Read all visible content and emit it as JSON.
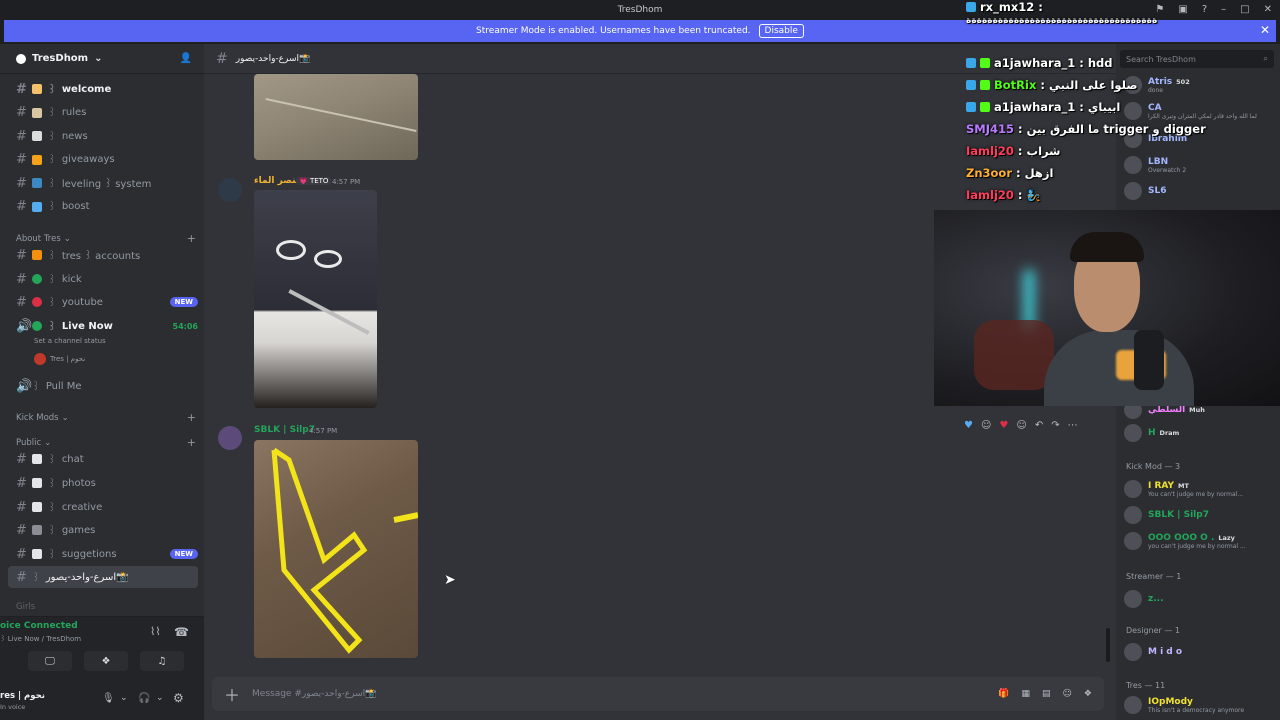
{
  "window": {
    "title": "TresDhom"
  },
  "banner": {
    "text": "Streamer Mode is enabled. Usernames have been truncated.",
    "button": "Disable"
  },
  "server": {
    "name": "TresDhom"
  },
  "channels": [
    {
      "label": "welcome",
      "emoji_color": "#f5c06b",
      "bold": true
    },
    {
      "label": "rules",
      "emoji_color": "#d9c7a4"
    },
    {
      "label": "news",
      "emoji_color": "#dcdcdc"
    },
    {
      "label": "giveaways",
      "emoji_color": "#f7a21b"
    },
    {
      "label": "leveling ꒱ system",
      "emoji_color": "#3b88c3"
    },
    {
      "label": "boost",
      "emoji_color": "#55acee"
    }
  ],
  "categories": {
    "about": "About Tres",
    "kickmods": "Kick Mods",
    "public": "Public",
    "girls": "Girls"
  },
  "about_channels": [
    {
      "label": "tres ꒱ accounts",
      "emoji_color": "#f4900c"
    },
    {
      "label": "kick",
      "emoji_color": "#23a55a"
    },
    {
      "label": "youtube",
      "emoji_color": "#da2f47",
      "badge": "NEW"
    },
    {
      "label": "Live Now",
      "emoji_color": "#23a55a",
      "timer": "54:06",
      "bold": true
    },
    {
      "label": "Pull Me"
    }
  ],
  "live_status": "Set a channel status",
  "live_user": "Tres | نحوم",
  "public_channels": [
    {
      "label": "chat",
      "emoji_color": "#e3e5e8"
    },
    {
      "label": "photos",
      "emoji_color": "#e3e5e8"
    },
    {
      "label": "creative",
      "emoji_color": "#e3e5e8"
    },
    {
      "label": "games",
      "emoji_color": "#8a8e94"
    },
    {
      "label": "suggetions",
      "emoji_color": "#e3e5e8",
      "badge": "NEW"
    },
    {
      "label": "اسرع-واحد-يصور📸",
      "active": true
    }
  ],
  "voice": {
    "status": "oice Connected",
    "sub": "꒱ Live Now / TresDhom",
    "user": "res | نحوم",
    "user_sub": "In voice"
  },
  "main": {
    "channel": "اسرع-واحد-يصور📸",
    "messages": [
      {
        "author": "عنصر الماء",
        "tag": "TETO",
        "time": "4:57 PM",
        "color": "#f0b232"
      },
      {
        "author": "SBLK | Silp7",
        "time": "4:57 PM",
        "color": "#23a55a"
      }
    ],
    "composer_placeholder": "Message #اسرع-واحد-يصور📸"
  },
  "members": {
    "search_placeholder": "Search TresDhom",
    "top": [
      {
        "name": "Atris",
        "badge": "502",
        "sub": "done",
        "color": "#a5b8ff"
      },
      {
        "name": "CA",
        "sub": "لما الله واحد قادر لمكي المثران وتيرى الكرا",
        "color": "#a5b8ff"
      },
      {
        "name": "Ibrahim",
        "color": "#a5b8ff"
      },
      {
        "name": "LBN",
        "sub": "Overwatch 2",
        "color": "#a5b8ff"
      },
      {
        "name": "SL6",
        "color": "#a5b8ff"
      }
    ],
    "under": [
      {
        "name": "السلطي",
        "badge": "Muh",
        "color": "#f47fff"
      },
      {
        "name": "H",
        "badge": "Dram",
        "color": "#23a55a"
      }
    ],
    "kickmod_header": "Kick Mod — 3",
    "kickmods": [
      {
        "name": "I RAY",
        "badge": "MT",
        "sub": "You can't judge me by normal...",
        "color": "#f0e130"
      },
      {
        "name": "SBLK | Silp7",
        "color": "#23a55a"
      },
      {
        "name": "ΟΟΟ ΟΟΟ Ο .",
        "badge": "Lazy",
        "sub": "you can't judge me by normal ...",
        "color": "#23a55a"
      }
    ],
    "streamer_header": "Streamer — 1",
    "streamer": {
      "name": "z...",
      "color": "#23a55a"
    },
    "designer_header": "Designer — 1",
    "designer": {
      "name": "M i d o",
      "color": "#bcb8ff"
    },
    "tres_header": "Tres — 11",
    "tres": {
      "name": "IOpMody",
      "sub": "This isn't a democracy anymore",
      "color": "#f0e130"
    }
  },
  "overlay_chat": [
    {
      "user": "rx_mx12",
      "text": ":",
      "color": "#ffffff",
      "badges": 1
    },
    {
      "user": "",
      "text": "ةةةةةةةةةةةةةةةةةةةةةةةةةةةةةةةةةةةة",
      "color": "#ffffff",
      "badges": 0
    },
    {
      "user": "a1jawhara_1",
      "text": ": hdd",
      "color": "#ffffff",
      "badges": 2
    },
    {
      "user": "BotRix",
      "text": ": صلوا على النبي",
      "color": "#53fc18",
      "badges": 2
    },
    {
      "user": "a1jawhara_1",
      "text": ": ابيباي",
      "color": "#ffffff",
      "badges": 2
    },
    {
      "user": "SMJ415",
      "text": ": ما الفرق بين trigger و digger",
      "color": "#b97cff",
      "badges": 0
    },
    {
      "user": "Iamlj20",
      "text": ": شراب",
      "color": "#ff3c5a",
      "badges": 0
    },
    {
      "user": "Zn3oor",
      "text": ": ازهل",
      "color": "#ffb02e",
      "badges": 0
    },
    {
      "user": "Iamlj20",
      "text": ": 🧞",
      "color": "#ff3c5a",
      "badges": 0
    }
  ]
}
